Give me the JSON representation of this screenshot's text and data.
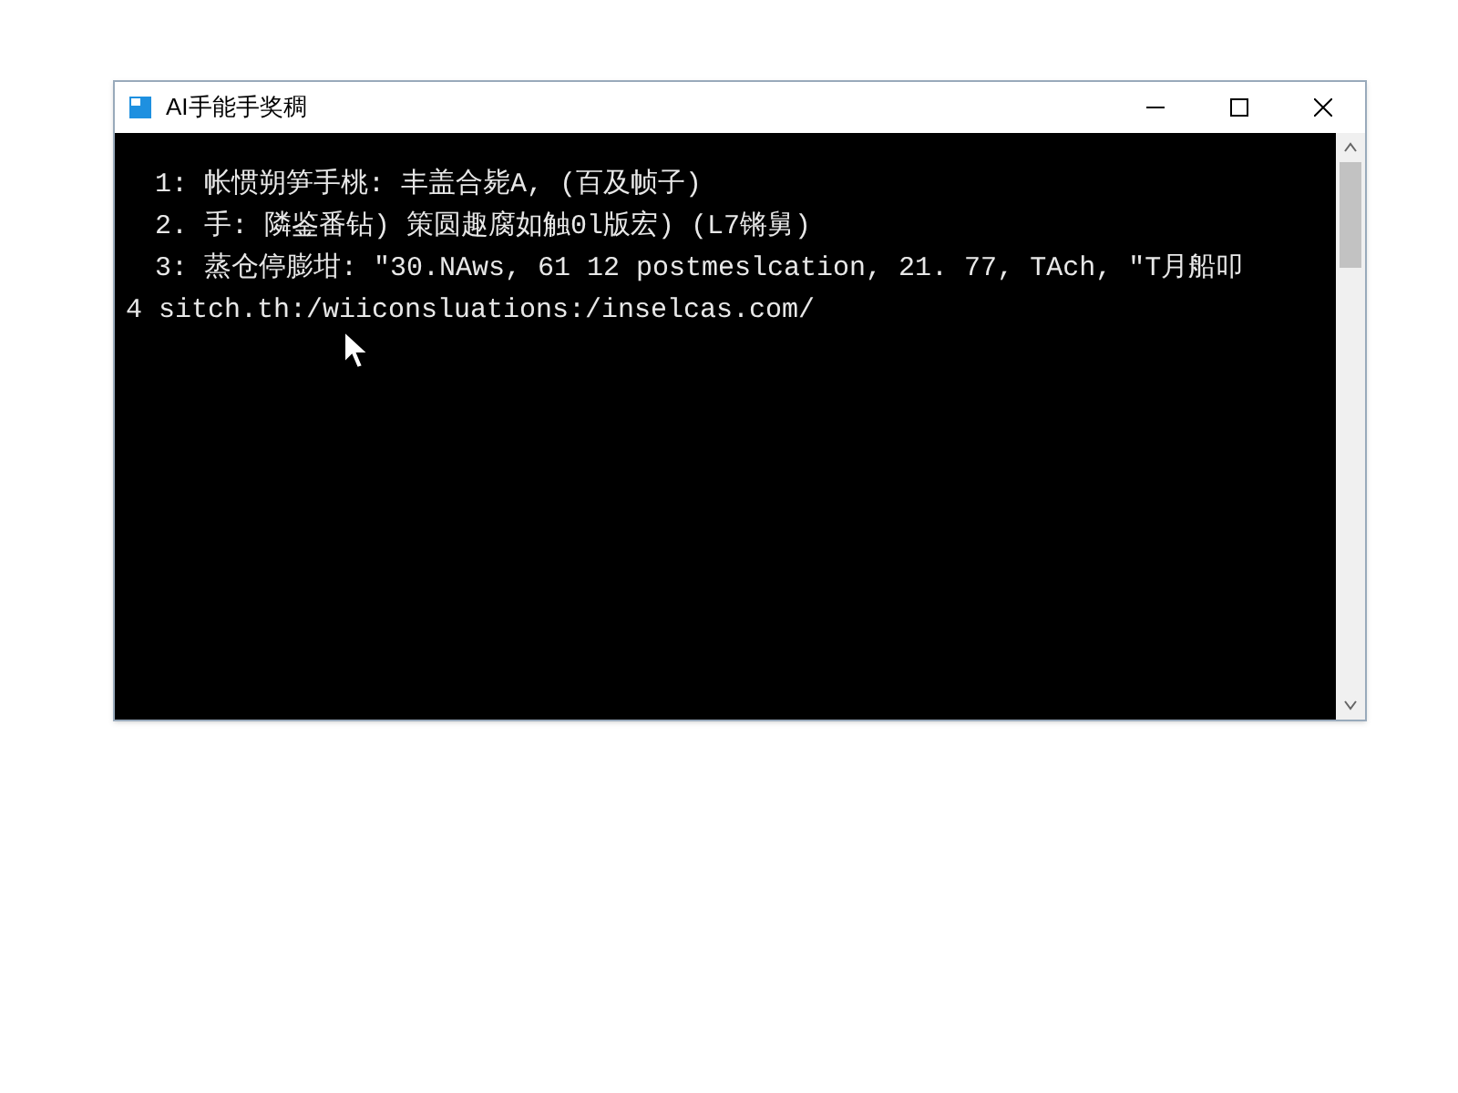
{
  "window": {
    "title": "AI手能手奖稠"
  },
  "console": {
    "lines": [
      {
        "text": "1: 帐惯朔笋手桃: 丰盖合毙A, (百及帧子)",
        "indented": true
      },
      {
        "text": "2. 手: 隣鉴番钻) 策圆趣腐如触0l版宏) (L7锵舅)",
        "indented": true
      },
      {
        "text": "3: 蒸仓停膨坩: \"30.NAws, 61 12 postmeslcation, 21. 77, TAch, \"T月船叩",
        "indented": true
      },
      {
        "text": "4 sitch.th:/wiiconsluations:/inselcas.com/",
        "indented": false
      }
    ]
  }
}
